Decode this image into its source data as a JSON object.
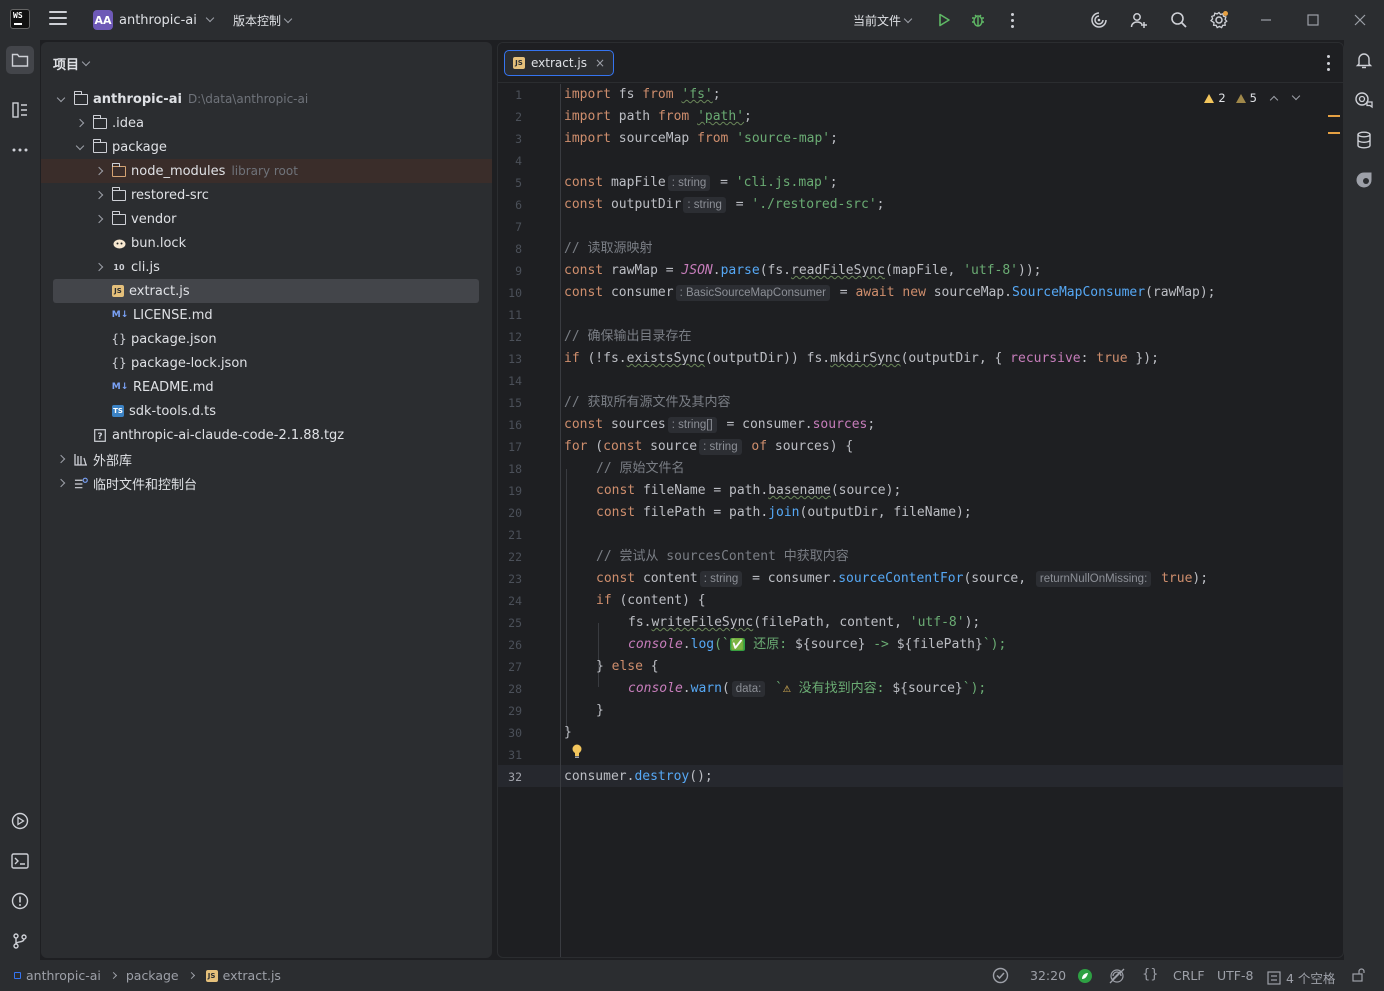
{
  "titlebar": {
    "logo_text": "WS",
    "project_avatar": "AA",
    "project_name": "anthropic-ai",
    "vcs_label": "版本控制",
    "run_config": "当前文件"
  },
  "icons": {
    "left_strip": [
      "folder-icon",
      "structure-icon",
      "more-icon",
      "run-icon",
      "terminal-icon",
      "problems-icon",
      "git-icon"
    ],
    "right_strip": [
      "bell-icon",
      "ai-chat-icon",
      "database-icon",
      "copilot-icon"
    ],
    "titlebar_right": [
      "run-icon",
      "debug-icon",
      "more-icon",
      "ai-icon",
      "add-user-icon",
      "search-icon",
      "settings-icon",
      "minimize-icon",
      "maximize-icon",
      "close-icon"
    ]
  },
  "project_panel": {
    "title": "项目",
    "tree": [
      {
        "label": "anthropic-ai",
        "path": "D:\\data\\anthropic-ai"
      },
      {
        "label": ".idea"
      },
      {
        "label": "package"
      },
      {
        "label": "node_modules",
        "note": "library root"
      },
      {
        "label": "restored-src"
      },
      {
        "label": "vendor"
      },
      {
        "label": "bun.lock"
      },
      {
        "label": "cli.js",
        "icon_text": "10"
      },
      {
        "label": "extract.js",
        "icon_text": "JS"
      },
      {
        "label": "LICENSE.md",
        "icon_text": "M↓"
      },
      {
        "label": "package.json",
        "icon_text": "{}"
      },
      {
        "label": "package-lock.json",
        "icon_text": "{}"
      },
      {
        "label": "README.md",
        "icon_text": "M↓"
      },
      {
        "label": "sdk-tools.d.ts",
        "icon_text": "TS"
      },
      {
        "label": "anthropic-ai-claude-code-2.1.88.tgz"
      },
      {
        "label": "外部库"
      },
      {
        "label": "临时文件和控制台"
      }
    ]
  },
  "editor": {
    "tab": {
      "label": "extract.js",
      "icon_text": "JS",
      "close": "×"
    },
    "warnings": {
      "errors": "2",
      "warnings": "5"
    },
    "current_line": 32,
    "line_numbers": [
      "1",
      "2",
      "3",
      "4",
      "5",
      "6",
      "7",
      "8",
      "9",
      "10",
      "11",
      "12",
      "13",
      "14",
      "15",
      "16",
      "17",
      "18",
      "19",
      "20",
      "21",
      "22",
      "23",
      "24",
      "25",
      "26",
      "27",
      "28",
      "29",
      "30",
      "31",
      "32"
    ],
    "code": {
      "l1": [
        "import",
        " fs ",
        "from",
        " ",
        "'fs'",
        ";"
      ],
      "l2": [
        "import",
        " path ",
        "from",
        " ",
        "'path'",
        ";"
      ],
      "l3": [
        "import",
        " sourceMap ",
        "from",
        " ",
        "'source-map'",
        ";"
      ],
      "l5": [
        "const",
        " mapFile",
        ": string",
        " = ",
        "'cli.js.map'",
        ";"
      ],
      "l6": [
        "const",
        " outputDir",
        ": string",
        " = ",
        "'./restored-src'",
        ";"
      ],
      "l8": "// 读取源映射",
      "l9": [
        "const",
        " rawMap = ",
        "JSON",
        ".",
        "parse",
        "(fs.",
        "readFileSync",
        "(mapFile, ",
        "'utf-8'",
        "));"
      ],
      "l10": [
        "const",
        " consumer",
        ": BasicSourceMapConsumer",
        " = ",
        "await",
        " ",
        "new",
        " sourceMap.",
        "SourceMapConsumer",
        "(rawMap);"
      ],
      "l12": "// 确保输出目录存在",
      "l13": [
        "if",
        " (!fs.",
        "existsSync",
        "(outputDir)) fs.",
        "mkdirSync",
        "(outputDir, { ",
        "recursive",
        ": ",
        "true",
        " });"
      ],
      "l15": "// 获取所有源文件及其内容",
      "l16": [
        "const",
        " sources",
        ": string[]",
        " = consumer.",
        "sources",
        ";"
      ],
      "l17": [
        "for",
        " (",
        "const",
        " source",
        ": string",
        " ",
        "of",
        " sources) {"
      ],
      "l18": "// 原始文件名",
      "l19": [
        "const",
        " fileName = path.",
        "basename",
        "(source);"
      ],
      "l20": [
        "const",
        " filePath = path.",
        "join",
        "(outputDir, fileName);"
      ],
      "l22": "// 尝试从 sourcesContent 中获取内容",
      "l23": [
        "const",
        " content",
        ": string",
        " = consumer.",
        "sourceContentFor",
        "(source, ",
        "returnNullOnMissing:",
        " ",
        "true",
        ");"
      ],
      "l24": [
        "if",
        " (content) {"
      ],
      "l25": [
        "fs.",
        "writeFileSync",
        "(filePath, content, ",
        "'utf-8'",
        ");"
      ],
      "l26": [
        "console",
        ".",
        "log",
        "(`",
        "✅",
        " 还原: ",
        "${source}",
        " -> ",
        "${filePath}",
        "`);"
      ],
      "l27": [
        "} ",
        "else",
        " {"
      ],
      "l28": [
        "console",
        ".",
        "warn",
        "(",
        "data:",
        " `",
        "⚠",
        " 没有找到内容: ",
        "${source}",
        "`);"
      ],
      "l29": "}",
      "l30": "}",
      "l32": [
        "consumer.",
        "destroy",
        "();"
      ]
    }
  },
  "statusbar": {
    "breadcrumb": [
      "anthropic-ai",
      "package",
      "extract.js"
    ],
    "cursor": "32:20",
    "line_sep": "CRLF",
    "encoding": "UTF-8",
    "indent": "4 个空格"
  },
  "colors": {
    "accent": "#3574f0",
    "keyword": "#cf8e6d",
    "string": "#6aab73",
    "function": "#56a8f5",
    "comment": "#7a7e85",
    "warning": "#f2c55c"
  }
}
